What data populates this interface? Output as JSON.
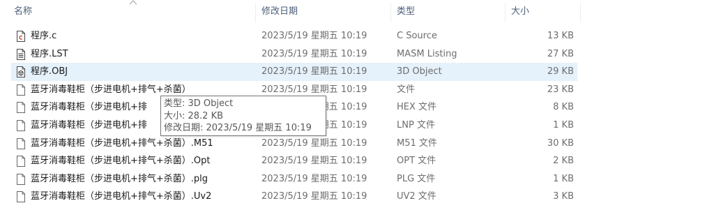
{
  "header": {
    "name": "名称",
    "date": "修改日期",
    "type": "类型",
    "size": "大小"
  },
  "files": [
    {
      "name": "程序.c",
      "date": "2023/5/19 星期五 10:19",
      "type": "C Source",
      "size": "13 KB",
      "icon": "c-source-file-icon"
    },
    {
      "name": "程序.LST",
      "date": "2023/5/19 星期五 10:19",
      "type": "MASM Listing",
      "size": "27 KB",
      "icon": "listing-file-icon"
    },
    {
      "name": "程序.OBJ",
      "date": "2023/5/19 星期五 10:19",
      "type": "3D Object",
      "size": "29 KB",
      "icon": "3d-object-file-icon"
    },
    {
      "name": "蓝牙消毒鞋柜（步进电机+排气+杀菌）",
      "date": "2023/5/19 星期五 10:19",
      "type": "文件",
      "size": "23 KB",
      "icon": "blank-file-icon"
    },
    {
      "name": "蓝牙消毒鞋柜（步进电机+排",
      "date": "2023/5/19 星期五 10:19",
      "type": "HEX 文件",
      "size": "8 KB",
      "icon": "blank-file-icon"
    },
    {
      "name": "蓝牙消毒鞋柜（步进电机+排",
      "date": "2023/5/19 星期五 10:19",
      "type": "LNP 文件",
      "size": "1 KB",
      "icon": "blank-file-icon"
    },
    {
      "name": "蓝牙消毒鞋柜（步进电机+排气+杀菌）.M51",
      "date": "2023/5/19 星期五 10:19",
      "type": "M51 文件",
      "size": "30 KB",
      "icon": "blank-file-icon"
    },
    {
      "name": "蓝牙消毒鞋柜（步进电机+排气+杀菌）.Opt",
      "date": "2023/5/19 星期五 10:19",
      "type": "OPT 文件",
      "size": "2 KB",
      "icon": "blank-file-icon"
    },
    {
      "name": "蓝牙消毒鞋柜（步进电机+排气+杀菌）.plg",
      "date": "2023/5/19 星期五 10:19",
      "type": "PLG 文件",
      "size": "1 KB",
      "icon": "blank-file-icon"
    },
    {
      "name": "蓝牙消毒鞋柜（步进电机+排气+杀菌）.Uv2",
      "date": "2023/5/19 星期五 10:19",
      "type": "UV2 文件",
      "size": "3 KB",
      "icon": "blank-file-icon"
    }
  ],
  "selected_index": 2,
  "tooltip": {
    "type_line": "类型: 3D Object",
    "size_line": "大小: 28.2 KB",
    "date_line": "修改日期: 2023/5/19 星期五 10:19"
  },
  "colors": {
    "header_text": "#4c607a",
    "selected_row": "#e5f1fb",
    "secondary_text": "#6d6d6d"
  }
}
